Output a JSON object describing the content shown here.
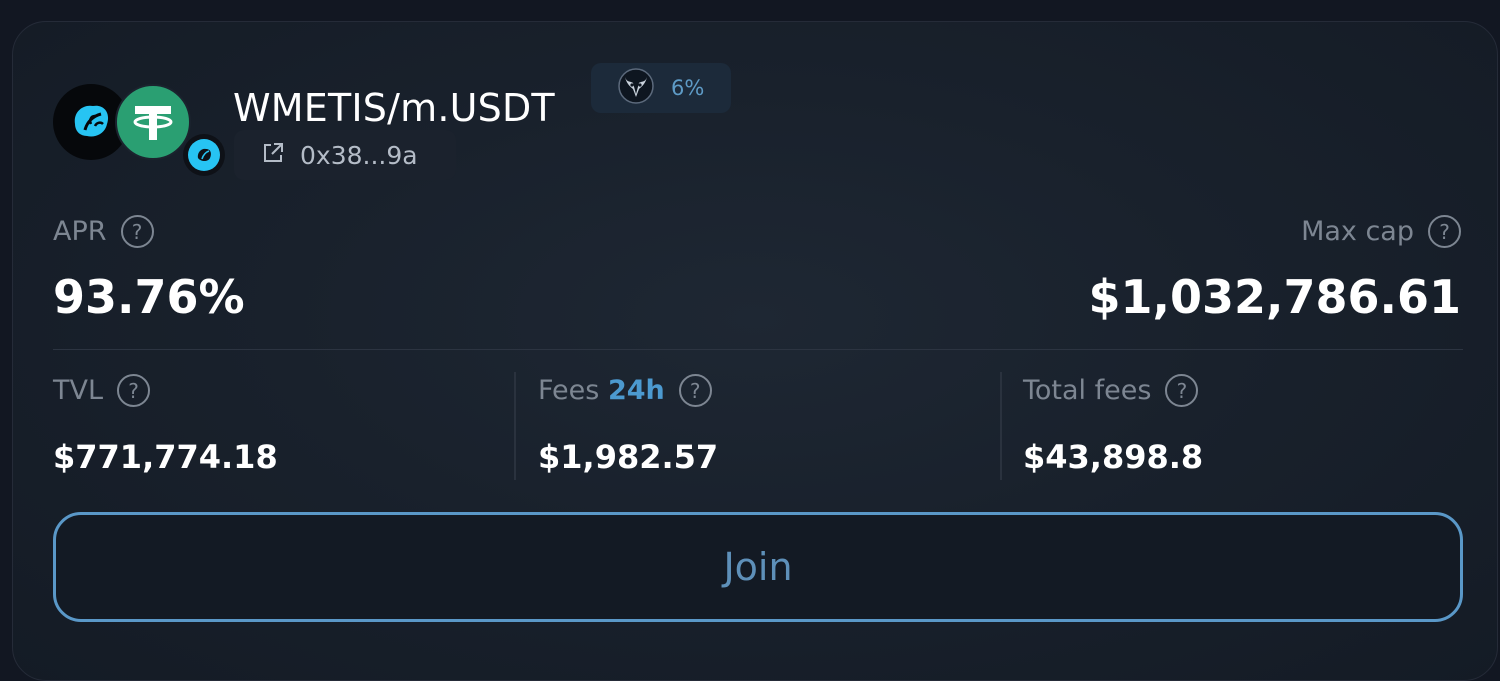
{
  "pool": {
    "name": "WMETIS/m.USDT",
    "fee_badge": "6%",
    "address": "0x38...9a",
    "token_icons": [
      "metis-icon",
      "usdt-icon",
      "metis-chain-icon"
    ],
    "badge_icon": "bull-emblem-icon",
    "address_icon": "external-link-icon"
  },
  "apr": {
    "label": "APR",
    "value": "93.76%"
  },
  "max_cap": {
    "label": "Max cap",
    "value": "$1,032,786.61"
  },
  "stats": {
    "tvl": {
      "label": "TVL",
      "value": "$771,774.18"
    },
    "fees": {
      "label": "Fees",
      "label_accent": "24h",
      "value": "$1,982.57"
    },
    "total_fees": {
      "label": "Total fees",
      "value": "$43,898.8"
    }
  },
  "help_icon_glyph": "?",
  "join_label": "Join",
  "colors": {
    "accent": "#4c9ad0",
    "button_border": "#5a98c8",
    "usdt_green": "#2a9f72",
    "metis_cyan": "#27c4f3"
  }
}
